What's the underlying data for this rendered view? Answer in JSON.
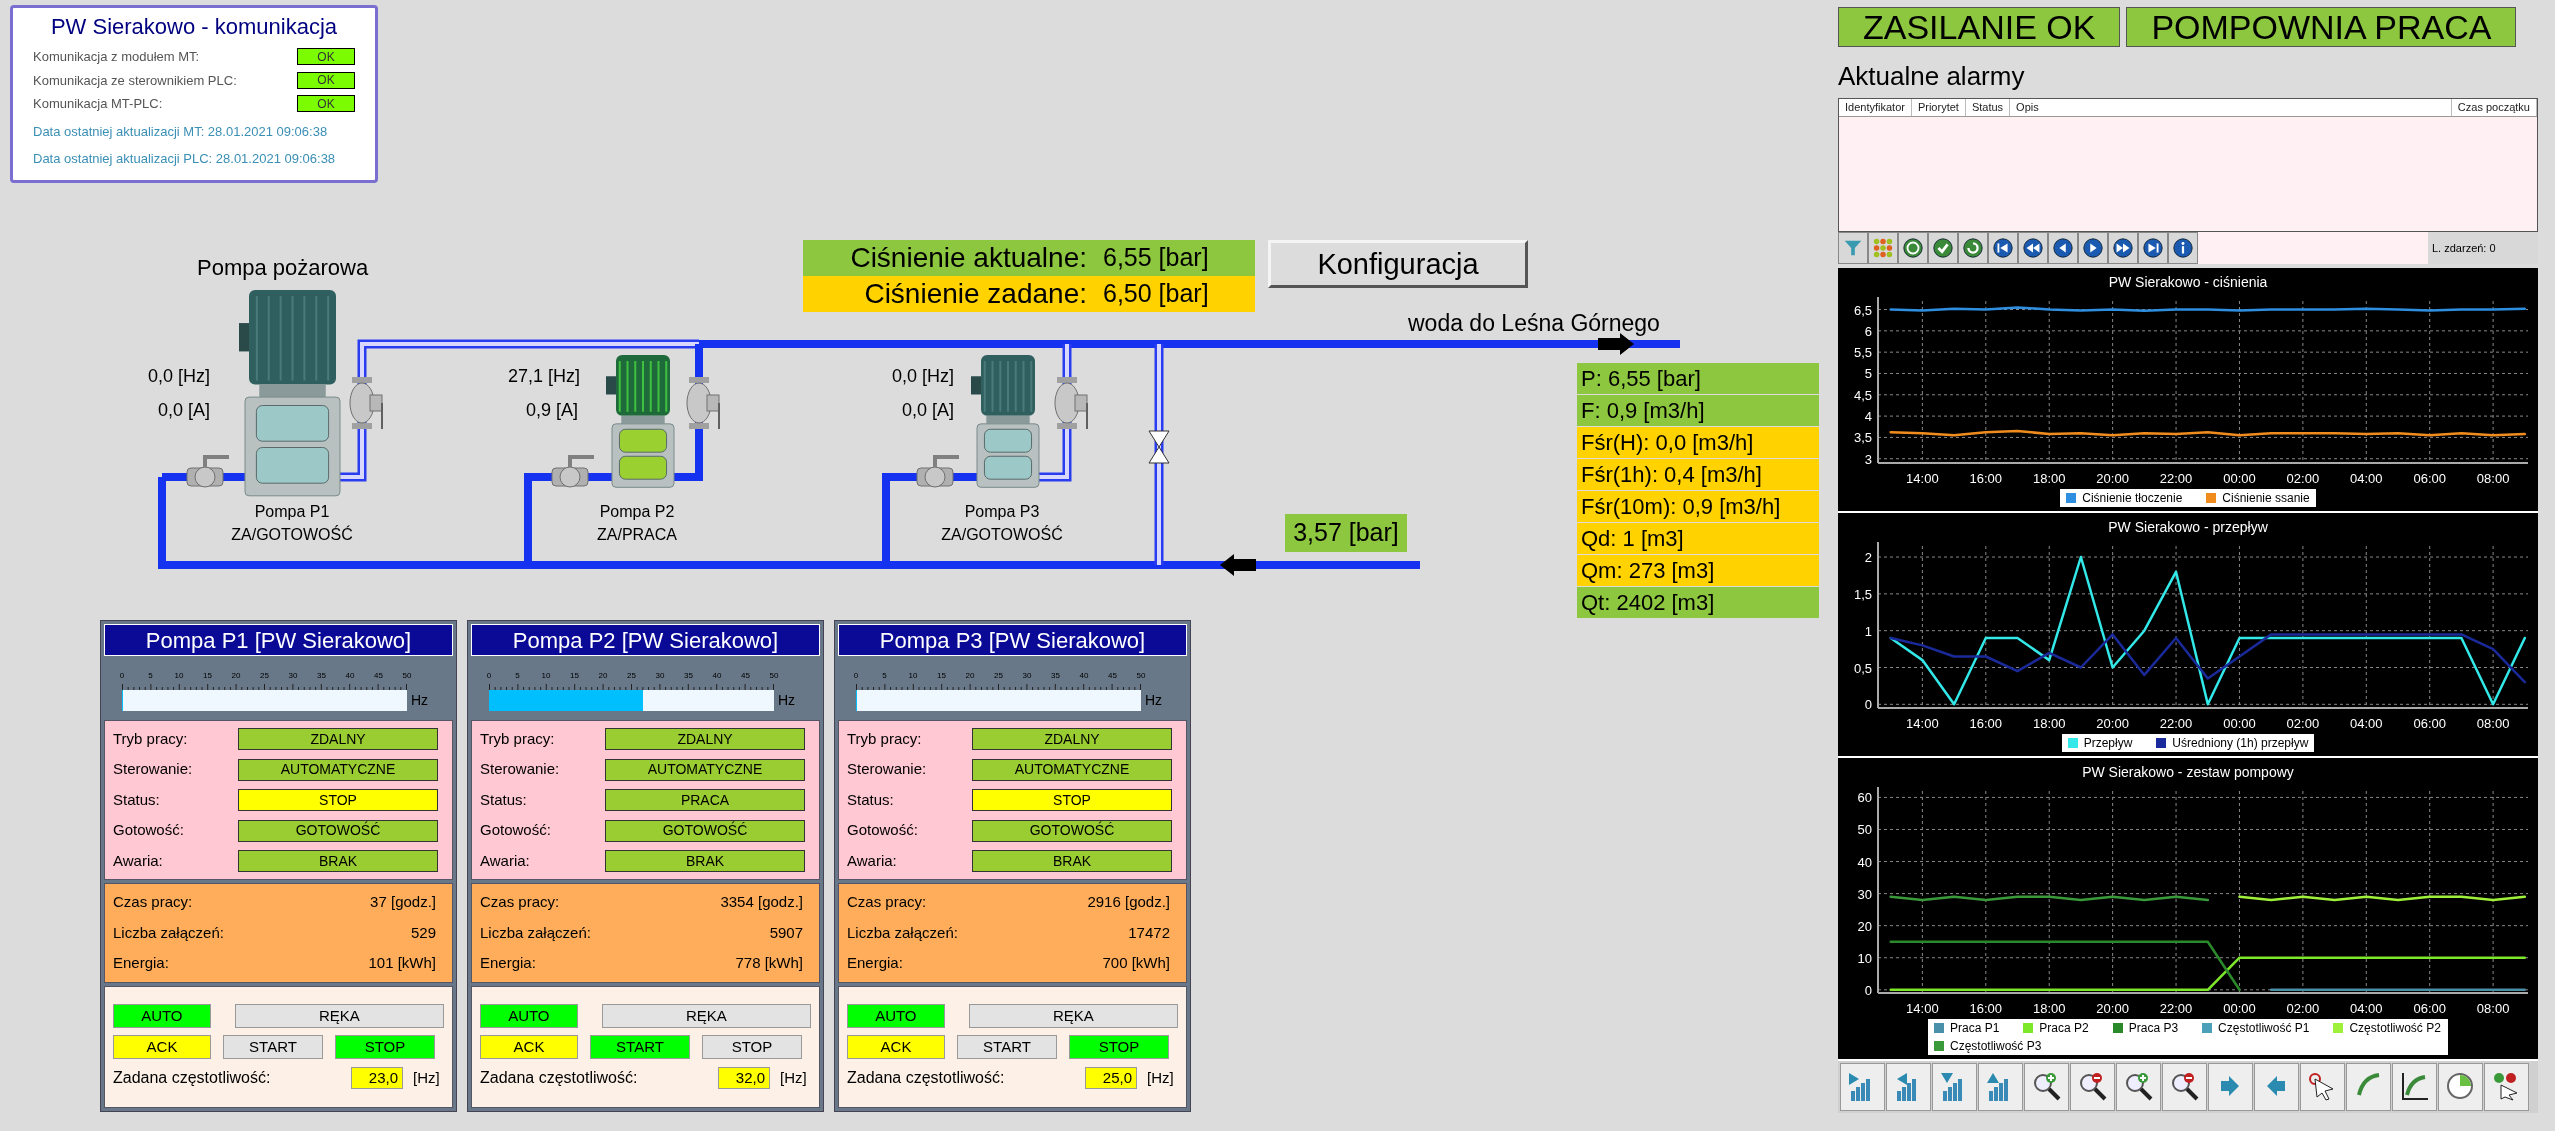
{
  "communication": {
    "title": "PW Sierakowo - komunikacja",
    "rows": [
      {
        "label": "Komunikacja z modułem MT:",
        "value": "OK"
      },
      {
        "label": "Komunikacja ze sterownikiem PLC:",
        "value": "OK"
      },
      {
        "label": "Komunikacja MT-PLC:",
        "value": "OK"
      }
    ],
    "updates": [
      "Data ostatniej aktualizacji MT: 28.01.2021 09:06:38",
      "Data ostatniej aktualizacji PLC: 28.01.2021 09:06:38"
    ]
  },
  "schematic": {
    "title": "Pompa pożarowa",
    "pressure": [
      {
        "label": "Ciśnienie aktualne:",
        "value": "6,55 [bar]",
        "color": "#8dc63f"
      },
      {
        "label": "Ciśnienie zadane:",
        "value": "6,50 [bar]",
        "color": "#ffd200"
      }
    ],
    "config_button": "Konfiguracja",
    "outlet_label": "woda do Leśna Górnego",
    "suction_pressure": "3,57 [bar]",
    "pumps": [
      {
        "frequency": "0,0 [Hz]",
        "current": "0,0 [A]",
        "name": "Pompa P1",
        "state": "ZA/GOTOWOŚĆ",
        "running": false
      },
      {
        "frequency": "27,1 [Hz]",
        "current": "0,9 [A]",
        "name": "Pompa P2",
        "state": "ZA/PRACA",
        "running": true
      },
      {
        "frequency": "0,0 [Hz]",
        "current": "0,0 [A]",
        "name": "Pompa P3",
        "state": "ZA/GOTOWOŚĆ",
        "running": false
      }
    ],
    "readings": [
      {
        "text": "P: 6,55 [bar]",
        "color": "#8dc63f"
      },
      {
        "text": "F: 0,9 [m3/h]",
        "color": "#8dc63f"
      },
      {
        "text": "Fśr(H): 0,0 [m3/h]",
        "color": "#ffd200"
      },
      {
        "text": "Fśr(1h): 0,4 [m3/h]",
        "color": "#ffd200"
      },
      {
        "text": "Fśr(10m): 0,9 [m3/h]",
        "color": "#ffd200"
      },
      {
        "text": "Qd: 1 [m3]",
        "color": "#ffd200"
      },
      {
        "text": "Qm: 273 [m3]",
        "color": "#ffd200"
      },
      {
        "text": "Qt: 2402 [m3]",
        "color": "#8dc63f"
      }
    ]
  },
  "pump_panels": [
    {
      "title": "Pompa P1 [PW Sierakowo]",
      "gauge": {
        "ticks": [
          "0",
          "5",
          "10",
          "15",
          "20",
          "25",
          "30",
          "35",
          "40",
          "45",
          "50"
        ],
        "unit": "Hz",
        "level": 0
      },
      "status": [
        {
          "label": "Tryb pracy:",
          "value": "ZDALNY",
          "color": "#9acd32"
        },
        {
          "label": "Sterowanie:",
          "value": "AUTOMATYCZNE",
          "color": "#9acd32"
        },
        {
          "label": "Status:",
          "value": "STOP",
          "color": "#ffff00"
        },
        {
          "label": "Gotowość:",
          "value": "GOTOWOŚĆ",
          "color": "#9acd32"
        },
        {
          "label": "Awaria:",
          "value": "BRAK",
          "color": "#9acd32"
        }
      ],
      "counters": [
        {
          "label": "Czas pracy:",
          "value": "37 [godz.]"
        },
        {
          "label": "Liczba załączeń:",
          "value": "529"
        },
        {
          "label": "Energia:",
          "value": "101 [kWh]"
        }
      ],
      "buttons": [
        {
          "label": "AUTO",
          "color": "#00ff00"
        },
        {
          "label": "RĘKA",
          "color": "#e3e3e3"
        },
        {
          "label": "ACK",
          "color": "#ffff00"
        },
        {
          "label": "START",
          "color": "#e3e3e3"
        },
        {
          "label": "STOP",
          "color": "#00ff00"
        }
      ],
      "setpoint": {
        "label": "Zadana częstotliwość:",
        "value": "23,0",
        "unit": "[Hz]"
      }
    },
    {
      "title": "Pompa P2 [PW Sierakowo]",
      "gauge": {
        "ticks": [
          "0",
          "5",
          "10",
          "15",
          "20",
          "25",
          "30",
          "35",
          "40",
          "45",
          "50"
        ],
        "unit": "Hz",
        "level": 0.542
      },
      "status": [
        {
          "label": "Tryb pracy:",
          "value": "ZDALNY",
          "color": "#9acd32"
        },
        {
          "label": "Sterowanie:",
          "value": "AUTOMATYCZNE",
          "color": "#9acd32"
        },
        {
          "label": "Status:",
          "value": "PRACA",
          "color": "#9acd32"
        },
        {
          "label": "Gotowość:",
          "value": "GOTOWOŚĆ",
          "color": "#9acd32"
        },
        {
          "label": "Awaria:",
          "value": "BRAK",
          "color": "#9acd32"
        }
      ],
      "counters": [
        {
          "label": "Czas pracy:",
          "value": "3354 [godz.]"
        },
        {
          "label": "Liczba załączeń:",
          "value": "5907"
        },
        {
          "label": "Energia:",
          "value": "778 [kWh]"
        }
      ],
      "buttons": [
        {
          "label": "AUTO",
          "color": "#00ff00"
        },
        {
          "label": "RĘKA",
          "color": "#e3e3e3"
        },
        {
          "label": "ACK",
          "color": "#ffff00"
        },
        {
          "label": "START",
          "color": "#00ff00"
        },
        {
          "label": "STOP",
          "color": "#e3e3e3"
        }
      ],
      "setpoint": {
        "label": "Zadana częstotliwość:",
        "value": "32,0",
        "unit": "[Hz]"
      }
    },
    {
      "title": "Pompa P3 [PW Sierakowo]",
      "gauge": {
        "ticks": [
          "0",
          "5",
          "10",
          "15",
          "20",
          "25",
          "30",
          "35",
          "40",
          "45",
          "50"
        ],
        "unit": "Hz",
        "level": 0
      },
      "status": [
        {
          "label": "Tryb pracy:",
          "value": "ZDALNY",
          "color": "#9acd32"
        },
        {
          "label": "Sterowanie:",
          "value": "AUTOMATYCZNE",
          "color": "#9acd32"
        },
        {
          "label": "Status:",
          "value": "STOP",
          "color": "#ffff00"
        },
        {
          "label": "Gotowość:",
          "value": "GOTOWOŚĆ",
          "color": "#9acd32"
        },
        {
          "label": "Awaria:",
          "value": "BRAK",
          "color": "#9acd32"
        }
      ],
      "counters": [
        {
          "label": "Czas pracy:",
          "value": "2916 [godz.]"
        },
        {
          "label": "Liczba załączeń:",
          "value": "17472"
        },
        {
          "label": "Energia:",
          "value": "700 [kWh]"
        }
      ],
      "buttons": [
        {
          "label": "AUTO",
          "color": "#00ff00"
        },
        {
          "label": "RĘKA",
          "color": "#e3e3e3"
        },
        {
          "label": "ACK",
          "color": "#ffff00"
        },
        {
          "label": "START",
          "color": "#e3e3e3"
        },
        {
          "label": "STOP",
          "color": "#00ff00"
        }
      ],
      "setpoint": {
        "label": "Zadana częstotliwość:",
        "value": "25,0",
        "unit": "[Hz]"
      }
    }
  ],
  "status_tiles": [
    "ZASILANIE OK",
    "POMPOWNIA PRACA"
  ],
  "alarms": {
    "title": "Aktualne alarmy",
    "columns": [
      "Identyfikator",
      "Priorytet",
      "Status",
      "Opis",
      "Czas początku"
    ],
    "event_count": "L. zdarzeń: 0"
  },
  "charts": [
    {
      "chart_data": {
        "type": "line",
        "title": "PW Sierakowo - ciśnienia",
        "grid": true,
        "legend": true,
        "x": [
          "2021-01-27T13:00",
          "2021-01-27T14:00",
          "2021-01-27T15:00",
          "2021-01-27T16:00",
          "2021-01-27T17:00",
          "2021-01-27T18:00",
          "2021-01-27T19:00",
          "2021-01-27T20:00",
          "2021-01-27T21:00",
          "2021-01-27T22:00",
          "2021-01-27T23:00",
          "2021-01-28T00:00",
          "2021-01-28T01:00",
          "2021-01-28T02:00",
          "2021-01-28T03:00",
          "2021-01-28T04:00",
          "2021-01-28T05:00",
          "2021-01-28T06:00",
          "2021-01-28T07:00",
          "2021-01-28T08:00",
          "2021-01-28T09:00"
        ],
        "xlim": [
          "2021-01-27T12:36",
          "2021-01-28T09:06"
        ],
        "ylim": [
          2.9,
          6.7
        ],
        "xticks": [
          {
            "value": "2021-01-27T14:00",
            "label": "14:00"
          },
          {
            "value": "2021-01-27T16:00",
            "label": "16:00"
          },
          {
            "value": "2021-01-27T18:00",
            "label": "18:00"
          },
          {
            "value": "2021-01-27T20:00",
            "label": "20:00"
          },
          {
            "value": "2021-01-27T22:00",
            "label": "22:00"
          },
          {
            "value": "2021-01-28T00:00",
            "label": "00:00"
          },
          {
            "value": "2021-01-28T02:00",
            "label": "02:00"
          },
          {
            "value": "2021-01-28T04:00",
            "label": "04:00"
          },
          {
            "value": "2021-01-28T06:00",
            "label": "06:00"
          },
          {
            "value": "2021-01-28T08:00",
            "label": "08:00"
          }
        ],
        "yticks": [
          {
            "value": 3,
            "label": "3"
          },
          {
            "value": 3.5,
            "label": "3,5"
          },
          {
            "value": 4,
            "label": "4"
          },
          {
            "value": 4.5,
            "label": "4,5"
          },
          {
            "value": 5,
            "label": "5"
          },
          {
            "value": 5.5,
            "label": "5,5"
          },
          {
            "value": 6,
            "label": "6"
          },
          {
            "value": 6.5,
            "label": "6,5"
          }
        ],
        "series": [
          {
            "name": "Ciśnienie tłoczenie",
            "color": "#2e8ee0",
            "values": [
              6.5,
              6.48,
              6.52,
              6.5,
              6.55,
              6.5,
              6.48,
              6.5,
              6.47,
              6.5,
              6.5,
              6.48,
              6.5,
              6.5,
              6.5,
              6.52,
              6.5,
              6.48,
              6.5,
              6.5,
              6.52
            ]
          },
          {
            "name": "Ciśnienie ssanie",
            "color": "#f08c1e",
            "values": [
              3.62,
              3.6,
              3.55,
              3.62,
              3.65,
              3.58,
              3.6,
              3.55,
              3.6,
              3.58,
              3.62,
              3.55,
              3.6,
              3.6,
              3.6,
              3.58,
              3.6,
              3.55,
              3.6,
              3.55,
              3.58
            ]
          }
        ]
      }
    },
    {
      "chart_data": {
        "type": "line",
        "title": "PW Sierakowo - przepływ",
        "grid": true,
        "legend": true,
        "x": [
          "2021-01-27T13:00",
          "2021-01-27T14:00",
          "2021-01-27T15:00",
          "2021-01-27T16:00",
          "2021-01-27T17:00",
          "2021-01-27T18:00",
          "2021-01-27T19:00",
          "2021-01-27T20:00",
          "2021-01-27T21:00",
          "2021-01-27T22:00",
          "2021-01-27T23:00",
          "2021-01-28T00:00",
          "2021-01-28T01:00",
          "2021-01-28T02:00",
          "2021-01-28T03:00",
          "2021-01-28T04:00",
          "2021-01-28T05:00",
          "2021-01-28T06:00",
          "2021-01-28T07:00",
          "2021-01-28T08:00",
          "2021-01-28T09:00"
        ],
        "xlim": [
          "2021-01-27T12:36",
          "2021-01-28T09:06"
        ],
        "ylim": [
          -0.05,
          2.15
        ],
        "xticks": [
          {
            "value": "2021-01-27T14:00",
            "label": "14:00"
          },
          {
            "value": "2021-01-27T16:00",
            "label": "16:00"
          },
          {
            "value": "2021-01-27T18:00",
            "label": "18:00"
          },
          {
            "value": "2021-01-27T20:00",
            "label": "20:00"
          },
          {
            "value": "2021-01-27T22:00",
            "label": "22:00"
          },
          {
            "value": "2021-01-28T00:00",
            "label": "00:00"
          },
          {
            "value": "2021-01-28T02:00",
            "label": "02:00"
          },
          {
            "value": "2021-01-28T04:00",
            "label": "04:00"
          },
          {
            "value": "2021-01-28T06:00",
            "label": "06:00"
          },
          {
            "value": "2021-01-28T08:00",
            "label": "08:00"
          }
        ],
        "yticks": [
          {
            "value": 0,
            "label": "0"
          },
          {
            "value": 0.5,
            "label": "0,5"
          },
          {
            "value": 1,
            "label": "1"
          },
          {
            "value": 1.5,
            "label": "1,5"
          },
          {
            "value": 2,
            "label": "2"
          }
        ],
        "series": [
          {
            "name": "Przepływ",
            "color": "#33e8e8",
            "values": [
              0.9,
              0.6,
              0,
              0.9,
              0.9,
              0.6,
              2,
              0.5,
              1,
              1.8,
              0,
              0.9,
              0.9,
              0.9,
              0.9,
              0.9,
              0.9,
              0.9,
              0.9,
              0,
              0.9
            ]
          },
          {
            "name": "Uśredniony (1h) przepływ",
            "color": "#1a2a9a",
            "values": [
              0.9,
              0.8,
              0.65,
              0.65,
              0.45,
              0.7,
              0.5,
              0.95,
              0.4,
              0.9,
              0.35,
              0.65,
              0.95,
              0.95,
              0.95,
              0.95,
              0.95,
              0.95,
              0.95,
              0.75,
              0.3
            ]
          }
        ]
      }
    },
    {
      "chart_data": {
        "type": "line",
        "title": "PW Sierakowo - zestaw pompowy",
        "grid": true,
        "legend": true,
        "x": [
          "2021-01-27T13:00",
          "2021-01-27T14:00",
          "2021-01-27T15:00",
          "2021-01-27T16:00",
          "2021-01-27T17:00",
          "2021-01-27T18:00",
          "2021-01-27T19:00",
          "2021-01-27T20:00",
          "2021-01-27T21:00",
          "2021-01-27T22:00",
          "2021-01-27T23:00",
          "2021-01-28T00:00",
          "2021-01-28T01:00",
          "2021-01-28T02:00",
          "2021-01-28T03:00",
          "2021-01-28T04:00",
          "2021-01-28T05:00",
          "2021-01-28T06:00",
          "2021-01-28T07:00",
          "2021-01-28T08:00",
          "2021-01-28T09:00"
        ],
        "xlim": [
          "2021-01-27T12:36",
          "2021-01-28T09:06"
        ],
        "ylim": [
          -1,
          62
        ],
        "xticks": [
          {
            "value": "2021-01-27T14:00",
            "label": "14:00"
          },
          {
            "value": "2021-01-27T16:00",
            "label": "16:00"
          },
          {
            "value": "2021-01-27T18:00",
            "label": "18:00"
          },
          {
            "value": "2021-01-27T20:00",
            "label": "20:00"
          },
          {
            "value": "2021-01-27T22:00",
            "label": "22:00"
          },
          {
            "value": "2021-01-28T00:00",
            "label": "00:00"
          },
          {
            "value": "2021-01-28T02:00",
            "label": "02:00"
          },
          {
            "value": "2021-01-28T04:00",
            "label": "04:00"
          },
          {
            "value": "2021-01-28T06:00",
            "label": "06:00"
          },
          {
            "value": "2021-01-28T08:00",
            "label": "08:00"
          }
        ],
        "yticks": [
          {
            "value": 0,
            "label": "0"
          },
          {
            "value": 10,
            "label": "10"
          },
          {
            "value": 20,
            "label": "20"
          },
          {
            "value": 30,
            "label": "30"
          },
          {
            "value": 40,
            "label": "40"
          },
          {
            "value": 50,
            "label": "50"
          },
          {
            "value": 60,
            "label": "60"
          }
        ],
        "series": [
          {
            "name": "Praca P1",
            "color": "#4a90a8",
            "values": [
              null,
              null,
              null,
              null,
              null,
              null,
              null,
              null,
              null,
              null,
              null,
              null,
              0,
              0,
              0,
              0,
              0,
              0,
              0,
              0,
              0
            ]
          },
          {
            "name": "Praca P2",
            "color": "#7de82a",
            "values": [
              0,
              0,
              0,
              0,
              0,
              0,
              0,
              0,
              0,
              0,
              0,
              10,
              10,
              10,
              10,
              10,
              10,
              10,
              10,
              10,
              10
            ]
          },
          {
            "name": "Praca P3",
            "color": "#2a8a2a",
            "values": [
              15,
              15,
              15,
              15,
              15,
              15,
              15,
              15,
              15,
              15,
              15,
              0,
              null,
              null,
              null,
              null,
              null,
              null,
              null,
              null,
              null
            ]
          },
          {
            "name": "Częstotliwość P1",
            "color": "#4aa0b8",
            "values": [
              null,
              null,
              null,
              null,
              null,
              null,
              null,
              null,
              null,
              null,
              null,
              null,
              null,
              null,
              null,
              null,
              null,
              null,
              null,
              null,
              null
            ]
          },
          {
            "name": "Częstotliwość P2",
            "color": "#9ef03a",
            "values": [
              null,
              null,
              null,
              null,
              null,
              null,
              null,
              null,
              null,
              null,
              null,
              29,
              28,
              29,
              28,
              29,
              28,
              29,
              29,
              28,
              29
            ]
          },
          {
            "name": "Częstotliwość P3",
            "color": "#3a9a3a",
            "values": [
              29,
              28,
              29,
              28,
              29,
              29,
              28,
              29,
              28,
              29,
              28,
              null,
              null,
              null,
              null,
              null,
              null,
              null,
              null,
              null,
              null
            ]
          }
        ]
      }
    }
  ]
}
